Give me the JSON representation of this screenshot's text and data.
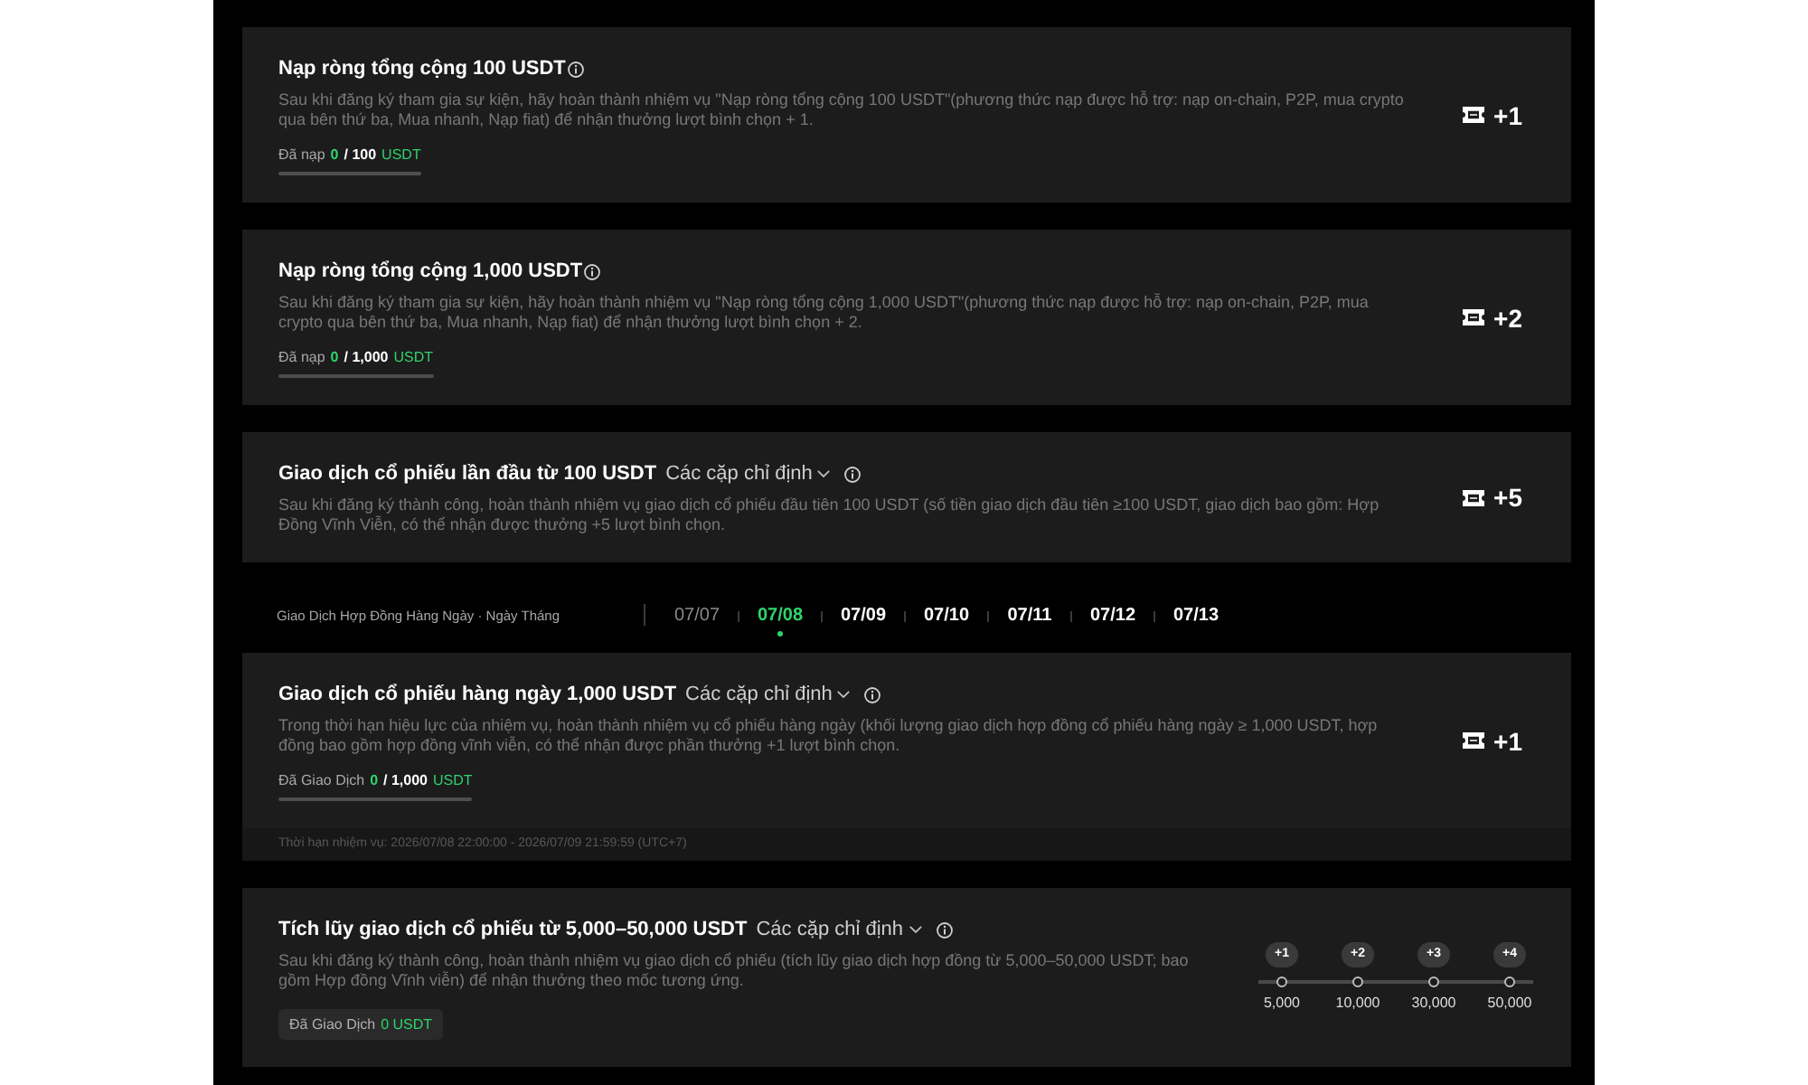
{
  "sections": [
    {
      "kind": "task",
      "title": "Nạp ròng tổng cộng 100 USDT",
      "description": "Sau khi đăng ký tham gia sự kiện, hãy hoàn thành nhiệm vụ \"Nạp ròng tổng cộng 100 USDT\"(phương thức nạp được hỗ trợ: nạp on-chain, P2P, mua crypto qua bên thứ ba, Mua nhanh, Nạp fiat) để nhận thưởng lượt bình chọn + 1.",
      "progress": {
        "kind": "bar",
        "label": "Đã nạp",
        "current": "0",
        "total": "/ 100",
        "unit": "USDT",
        "level": 0
      },
      "reward": "+1"
    },
    {
      "kind": "task",
      "title": "Nạp ròng tổng cộng 1,000 USDT",
      "description": "Sau khi đăng ký tham gia sự kiện, hãy hoàn thành nhiệm vụ \"Nạp ròng tổng cộng 1,000 USDT\"(phương thức nạp được hỗ trợ: nạp on-chain, P2P, mua crypto qua bên thứ ba, Mua nhanh, Nạp fiat) để nhận thưởng lượt bình chọn + 2.",
      "progress": {
        "kind": "bar",
        "label": "Đã nạp",
        "current": "0",
        "total": "/ 1,000",
        "unit": "USDT",
        "level": 0
      },
      "reward": "+2"
    },
    {
      "kind": "task",
      "title": "Giao dịch cổ phiếu lần đầu từ 100 USDT",
      "pairs_selector": "Các cặp chỉ định",
      "description": "Sau khi đăng ký thành công, hoàn thành nhiệm vụ giao dịch cổ phiếu đầu tiên 100 USDT (số tiền giao dịch đầu tiên ≥100 USDT, giao dịch bao gồm: Hợp Đồng Vĩnh Viễn, có thể nhận được thưởng +5 lượt bình chọn.",
      "reward": "+5"
    },
    {
      "kind": "date_tabs",
      "label": "Giao Dịch Hợp Đồng Hàng Ngày · Ngày Tháng",
      "dates": [
        {
          "label": "07/07",
          "selected": false,
          "past": true
        },
        {
          "label": "07/08",
          "selected": true,
          "past": false
        },
        {
          "label": "07/09",
          "selected": false,
          "past": false
        },
        {
          "label": "07/10",
          "selected": false,
          "past": false
        },
        {
          "label": "07/11",
          "selected": false,
          "past": false
        },
        {
          "label": "07/12",
          "selected": false,
          "past": false
        },
        {
          "label": "07/13",
          "selected": false,
          "past": false
        }
      ]
    },
    {
      "kind": "task",
      "title": "Giao dịch cổ phiếu hàng ngày 1,000 USDT",
      "pairs_selector": "Các cặp chỉ định",
      "description": "Trong thời hạn hiệu lực của nhiệm vụ, hoàn thành nhiệm vụ cổ phiếu hàng ngày (khối lượng giao dịch hợp đồng cổ phiếu hàng ngày ≥ 1,000 USDT, hợp đồng bao gồm hợp đồng vĩnh viễn, có thể nhận được phần thưởng +1 lượt bình chọn.",
      "progress": {
        "kind": "bar",
        "label": "Đã Giao Dịch",
        "current": "0",
        "total": "/ 1,000",
        "unit": "USDT",
        "level": 0
      },
      "reward": "+1",
      "footer": "Thời hạn nhiệm vụ: 2026/07/08 22:00:00 - 2026/07/09 21:59:59 (UTC+7)"
    },
    {
      "kind": "task",
      "title": "Tích lũy giao dịch cổ phiếu từ 5,000–50,000 USDT",
      "pairs_selector": "Các cặp chỉ định",
      "description": "Sau khi đăng ký thành công, hoàn thành nhiệm vụ giao dịch cổ phiếu (tích lũy giao dịch hợp đồng từ 5,000–50,000 USDT; bao gồm Hợp đồng Vĩnh viễn) để nhận thưởng theo mốc tương ứng.",
      "progress": {
        "kind": "chip",
        "label": "Đã Giao Dịch",
        "current": "0 USDT"
      },
      "milestones": {
        "level": 0,
        "steps": [
          {
            "reward": "+1",
            "amount": "5,000"
          },
          {
            "reward": "+2",
            "amount": "10,000"
          },
          {
            "reward": "+3",
            "amount": "30,000"
          },
          {
            "reward": "+4",
            "amount": "50,000"
          }
        ]
      }
    }
  ]
}
